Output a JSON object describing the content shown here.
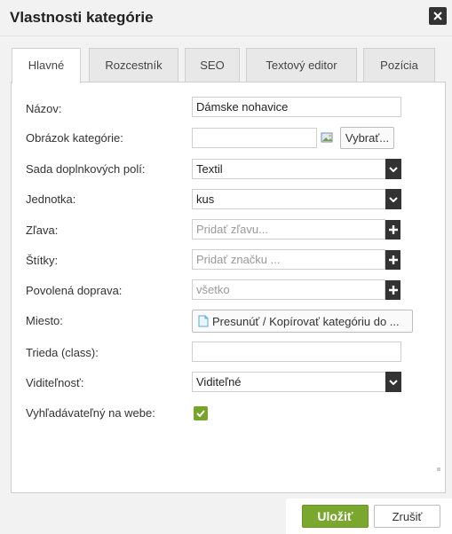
{
  "dialog": {
    "title": "Vlastnosti kategórie"
  },
  "tabs": [
    {
      "label": "Hlavné"
    },
    {
      "label": "Rozcestník"
    },
    {
      "label": "SEO"
    },
    {
      "label": "Textový editor"
    },
    {
      "label": "Pozícia"
    }
  ],
  "form": {
    "name_label": "Názov:",
    "name_value": "Dámske nohavice",
    "image_label": "Obrázok kategórie:",
    "image_value": "",
    "image_browse_label": "Vybrať...",
    "fieldset_label": "Sada doplnkových polí:",
    "fieldset_value": "Textil",
    "unit_label": "Jednotka:",
    "unit_value": "kus",
    "discount_label": "Zľava:",
    "discount_placeholder": "Pridať zľavu...",
    "tags_label": "Štítky:",
    "tags_placeholder": "Pridať značku ...",
    "shipping_label": "Povolená doprava:",
    "shipping_value": "všetko",
    "location_label": "Miesto:",
    "location_button_label": "Presunúť / Kopírovať kategóriu do ...",
    "class_label": "Trieda (class):",
    "class_value": "",
    "visibility_label": "Viditeľnosť:",
    "visibility_value": "Viditeľné",
    "searchable_label": "Vyhľadávateľný na webe:",
    "searchable_checked": true
  },
  "footer": {
    "save_label": "Uložiť",
    "cancel_label": "Zrušiť"
  },
  "colors": {
    "accent_green": "#7aa72e",
    "dark_control": "#333333"
  }
}
